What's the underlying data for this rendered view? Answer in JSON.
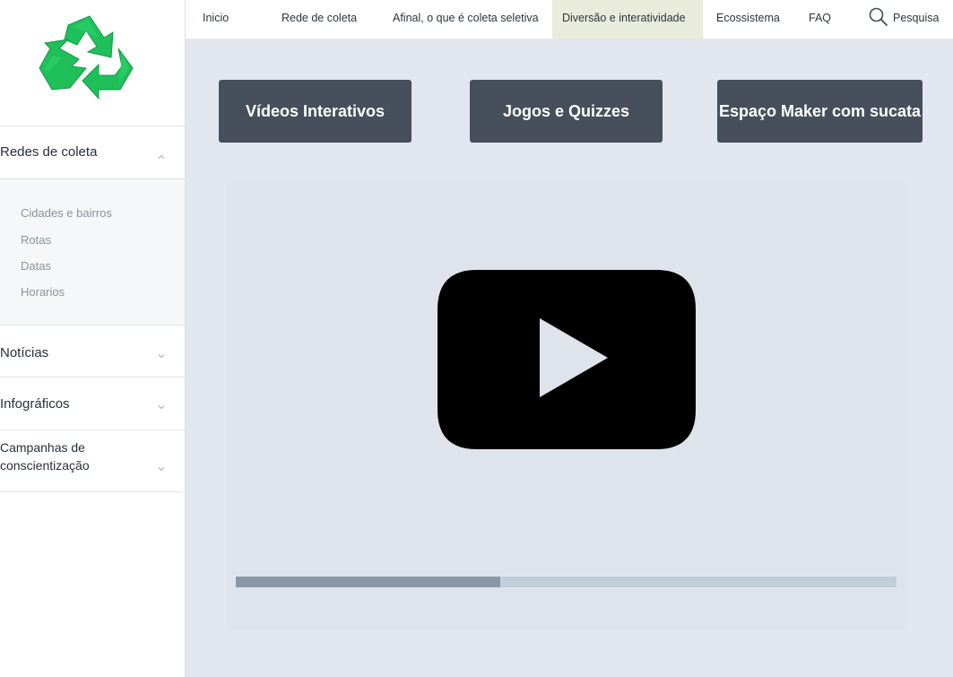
{
  "sidebar": {
    "logo": {
      "icon": "recycle-icon",
      "color": "#1fbf5a"
    },
    "sections": [
      {
        "label": "Redes de coleta",
        "icon": "chevron-up-icon",
        "expanded": true
      },
      {
        "label": "Notícias",
        "icon": "chevron-down-icon",
        "expanded": false
      },
      {
        "label": "Infográficos",
        "icon": "chevron-down-icon",
        "expanded": false
      },
      {
        "label_line1": "Campanhas de",
        "label_line2": "conscientização",
        "icon": "chevron-down-icon",
        "expanded": false
      }
    ],
    "subitems": [
      "Cidades e bairros",
      "Rotas",
      "Datas",
      "Horarios"
    ]
  },
  "nav": {
    "items": [
      "Inicio",
      "Rede de coleta",
      "Afinal, o que é coleta seletiva",
      "Diversão e interatividade",
      "Ecossistema",
      "FAQ"
    ],
    "active_index": 3,
    "active_color": "#e9ecda",
    "search_label": "Pesquisa",
    "search_icon": "search-icon"
  },
  "categories": [
    "Vídeos Interativos",
    "Jogos e Quizzes",
    "Espaço Maker com sucata"
  ],
  "category_color": "#464f5b",
  "video": {
    "play_icon": "youtube-play-icon",
    "progress_fraction": 0.4
  }
}
